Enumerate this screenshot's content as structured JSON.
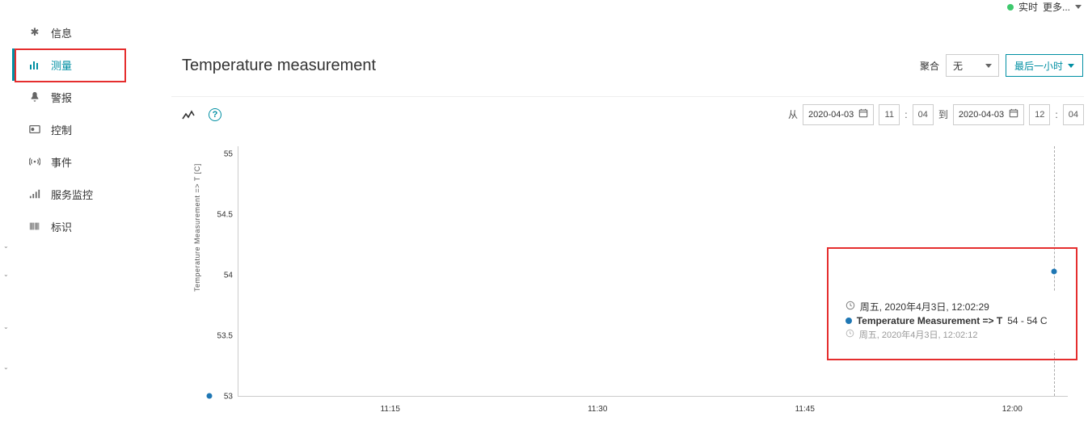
{
  "top_right": {
    "status_label": "实时",
    "more_label": "更多..."
  },
  "sidebar": {
    "items": [
      {
        "label": "信息"
      },
      {
        "label": "测量"
      },
      {
        "label": "警报"
      },
      {
        "label": "控制"
      },
      {
        "label": "事件"
      },
      {
        "label": "服务监控"
      },
      {
        "label": "标识"
      }
    ]
  },
  "header": {
    "title": "Temperature measurement",
    "aggregate_label": "聚合",
    "aggregate_value": "无",
    "range_label": "最后一小时"
  },
  "date_range": {
    "from_label": "从",
    "to_label": "到",
    "from_date": "2020-04-03",
    "from_h": "11",
    "from_m": "04",
    "colon": ":",
    "to_date": "2020-04-03",
    "to_h": "12",
    "to_m": "04"
  },
  "chart_data": {
    "type": "scatter",
    "title": "",
    "xlabel": "",
    "ylabel": "Temperature Measurement => T [C]",
    "ylim": [
      53,
      55
    ],
    "yticks": [
      53,
      53.5,
      54,
      54.5,
      55
    ],
    "xticks": [
      "11:15",
      "11:30",
      "11:45",
      "12:00"
    ],
    "series": [
      {
        "name": "Temperature Measurement => T",
        "color": "#1f77b4",
        "points": [
          {
            "time": "11:04",
            "value": 53
          },
          {
            "time": "12:02",
            "value": 54
          }
        ]
      }
    ]
  },
  "tooltip": {
    "timestamp": "周五, 2020年4月3日, 12:02:29",
    "series_name": "Temperature Measurement => T",
    "value_text": " 54 - 54 C",
    "prev_timestamp": "周五, 2020年4月3日, 12:02:12"
  }
}
